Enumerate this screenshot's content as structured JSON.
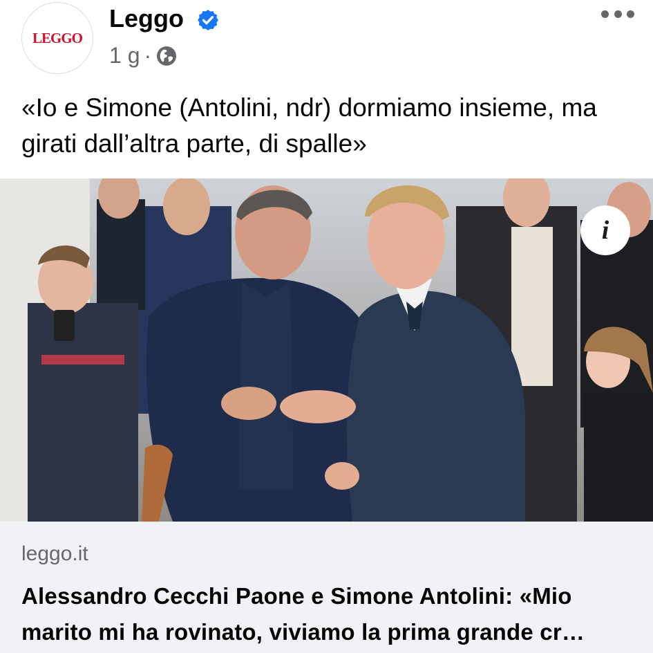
{
  "post": {
    "page_name": "Leggo",
    "avatar_text": "LEGGO",
    "verified": true,
    "time": "1 g",
    "separator": "·",
    "audience_icon": "globe-icon",
    "more_icon": "more-horizontal-icon",
    "text": "«Io e Simone (Antolini, ndr) dormiamo insieme, ma girati dall’altra parte, di spalle»"
  },
  "photo": {
    "info_icon": "info-icon",
    "info_glyph": "i"
  },
  "link": {
    "domain": "leggo.it",
    "title_line1": "Alessandro Cecchi Paone e Simone Antolini: «Mio",
    "title_line2": "marito mi ha rovinato, viviamo la prima grande cr…"
  },
  "colors": {
    "brand_red": "#d0112b",
    "verified_blue": "#1877f2",
    "secondary_text": "#65676b",
    "card_background": "#f0f2f5"
  }
}
